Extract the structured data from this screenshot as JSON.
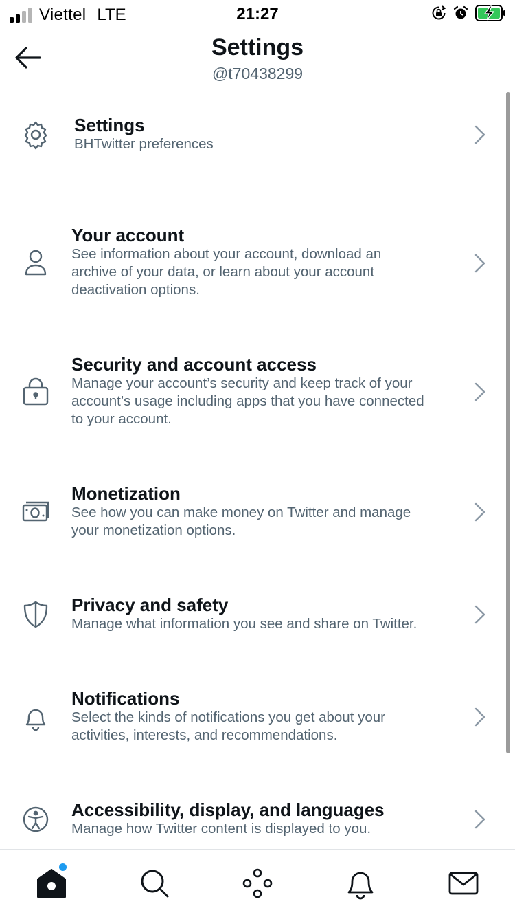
{
  "status_bar": {
    "carrier": "Viettel",
    "network": "LTE",
    "time": "21:27",
    "signal_bars_active": 2,
    "signal_bars_total": 4,
    "icons": [
      "orientation-lock-icon",
      "alarm-icon",
      "battery-charging-icon"
    ],
    "battery_color": "#34c759"
  },
  "header": {
    "title": "Settings",
    "handle": "@t70438299"
  },
  "settings_list": [
    {
      "icon": "gear-icon",
      "title": "Settings",
      "lines": [
        "BHTwitter preferences"
      ]
    },
    {
      "icon": "person-icon",
      "title": "Your account",
      "lines": [
        "See information about your account, download an",
        "archive of your data, or learn about your account",
        "deactivation options."
      ]
    },
    {
      "icon": "lock-icon",
      "title": "Security and account access",
      "lines": [
        "Manage your account’s security and keep track of your",
        "account’s usage including apps that you have connected",
        "to your account."
      ]
    },
    {
      "icon": "money-icon",
      "title": "Monetization",
      "lines": [
        "See how you can make money on Twitter and manage",
        "your monetization options."
      ]
    },
    {
      "icon": "shield-icon",
      "title": "Privacy and safety",
      "lines": [
        "Manage what information you see and share on Twitter."
      ]
    },
    {
      "icon": "bell-icon",
      "title": "Notifications",
      "lines": [
        "Select the kinds of notifications you get about your",
        "activities, interests, and recommendations."
      ]
    },
    {
      "icon": "accessibility-icon",
      "title": "Accessibility, display, and languages",
      "lines": [
        "Manage how Twitter content is displayed to you."
      ]
    }
  ],
  "tab_bar": {
    "tabs": [
      "home-icon",
      "search-icon",
      "spaces-icon",
      "notifications-icon",
      "messages-icon"
    ],
    "active": "home-icon",
    "badge_color": "#1d9bf0"
  },
  "colors": {
    "primary_text": "#0f1419",
    "secondary_text": "#536471",
    "chevron": "#8b98a5",
    "accent": "#1d9bf0"
  }
}
